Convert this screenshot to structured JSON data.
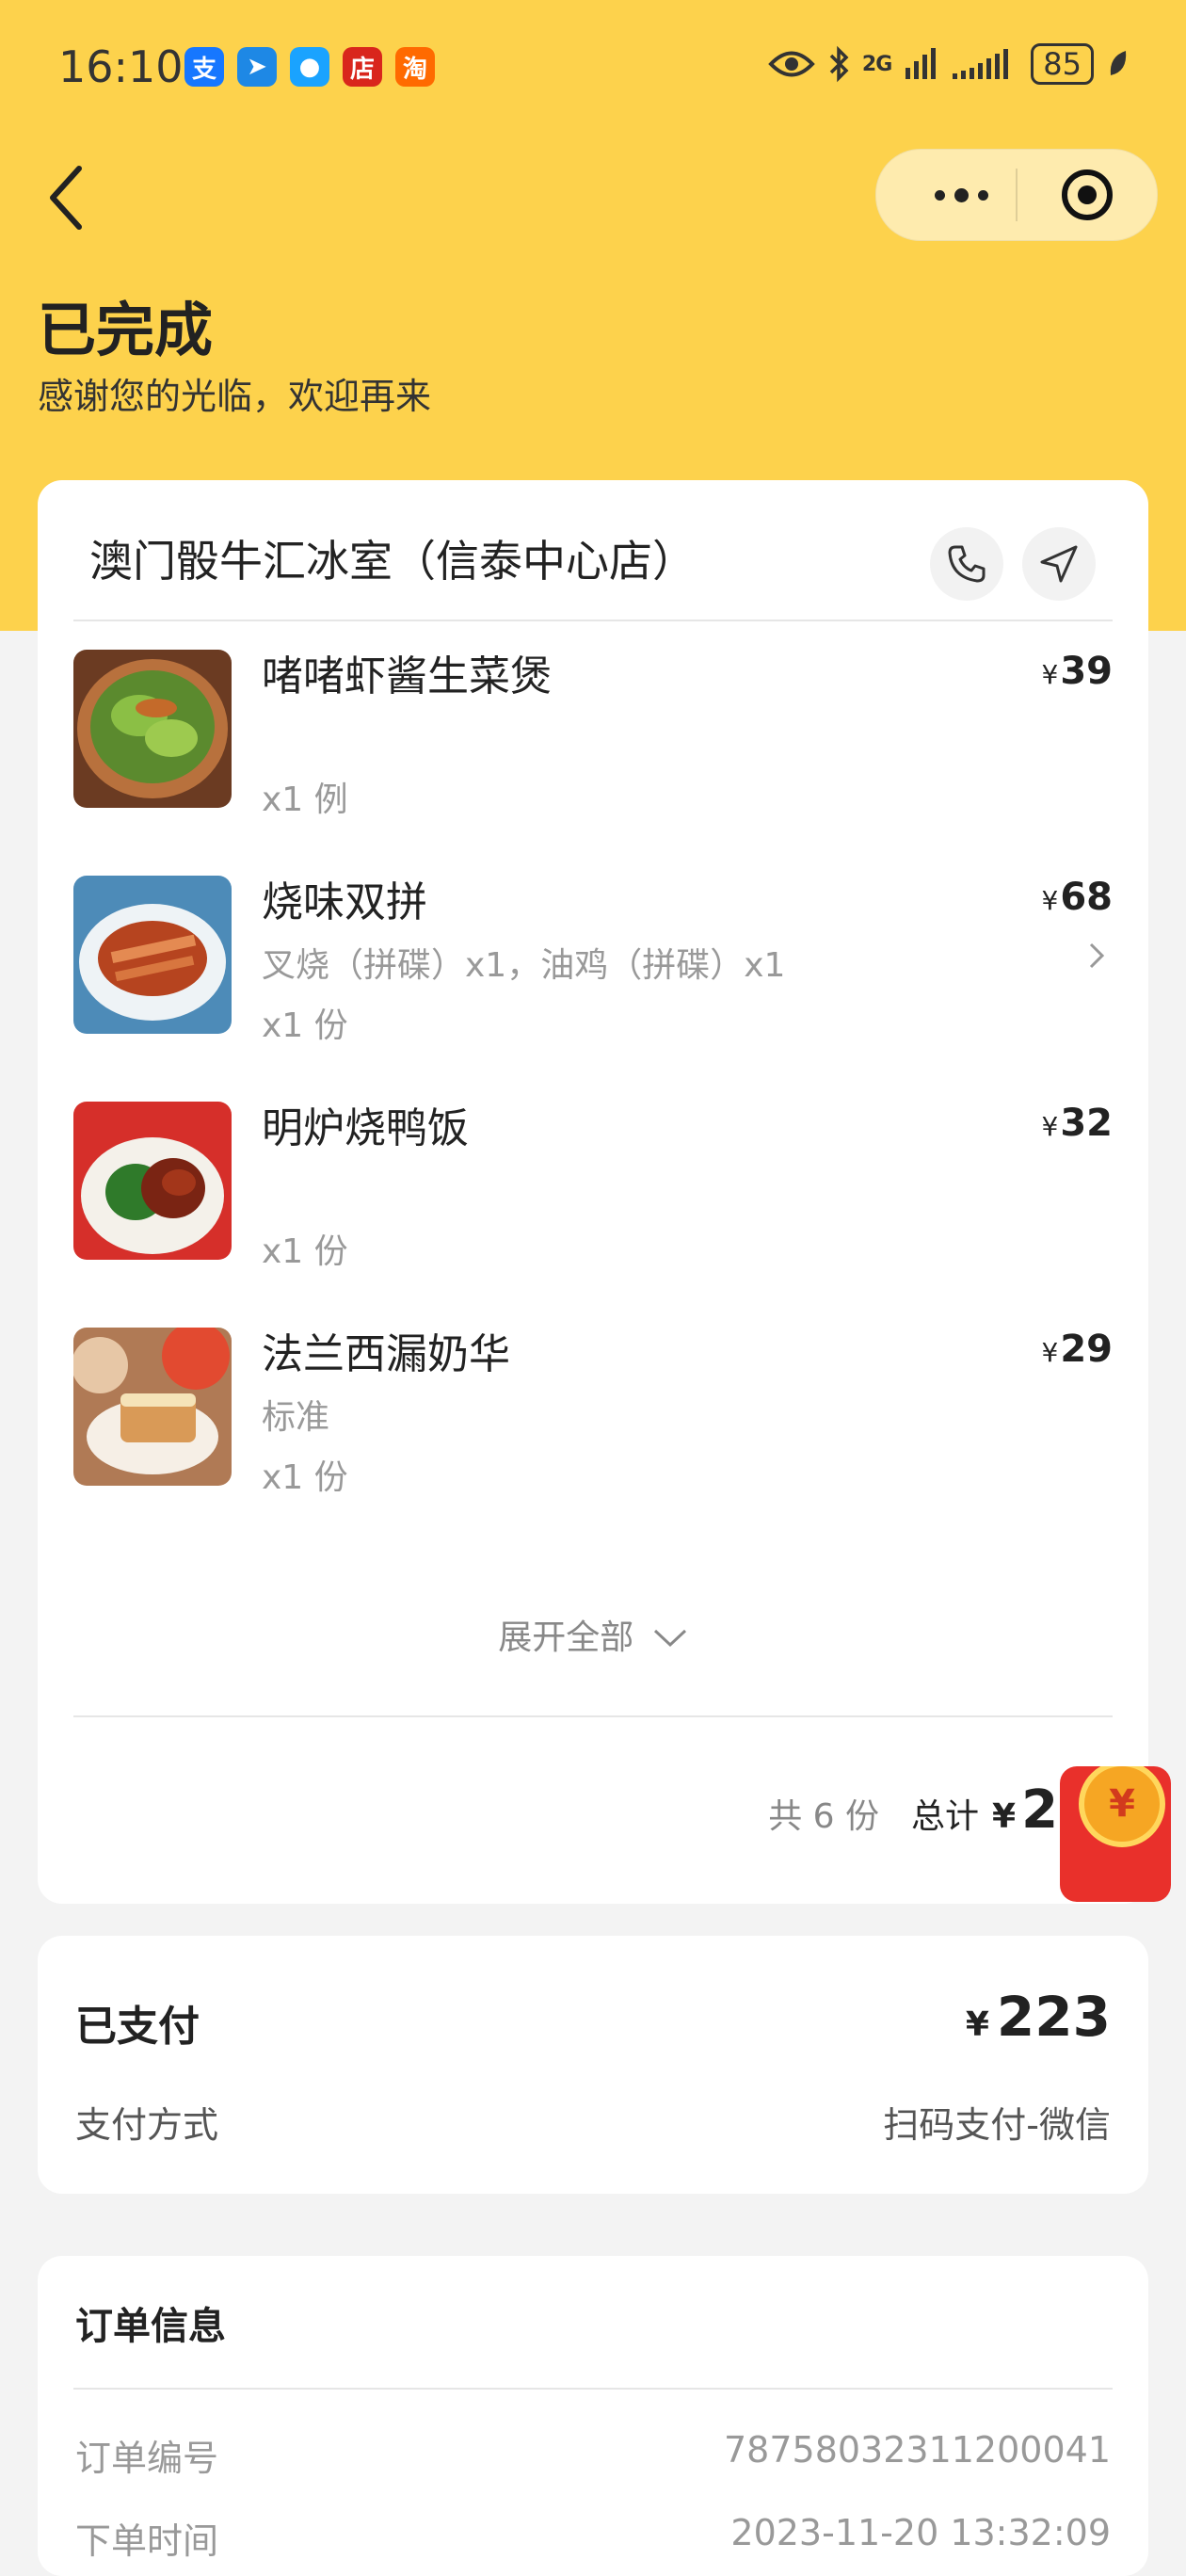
{
  "status_bar": {
    "time": "16:10",
    "apps": [
      {
        "glyph": "支",
        "color": "#1677ff"
      },
      {
        "glyph": "➤",
        "color": "#1e88e5"
      },
      {
        "glyph": "●",
        "color": "#1aa3ff"
      },
      {
        "glyph": "店",
        "color": "#d9261c"
      },
      {
        "glyph": "淘",
        "color": "#ff6a00"
      }
    ],
    "network": "2G",
    "battery": "85"
  },
  "header": {
    "status_title": "已完成",
    "status_subtitle": "感谢您的光临，欢迎再来"
  },
  "shop": {
    "name": "澳门骰牛汇冰室（信泰中心店）"
  },
  "items": [
    {
      "name": "啫啫虾酱生菜煲",
      "spec": "",
      "qty": "x1 例",
      "currency": "¥",
      "price": "39",
      "has_arrow": false
    },
    {
      "name": "烧味双拼",
      "spec": "叉烧（拼碟）x1，油鸡（拼碟）x1",
      "qty": "x1 份",
      "currency": "¥",
      "price": "68",
      "has_arrow": true
    },
    {
      "name": "明炉烧鸭饭",
      "spec": "",
      "qty": "x1 份",
      "currency": "¥",
      "price": "32",
      "has_arrow": false
    },
    {
      "name": "法兰西漏奶华",
      "spec": "标准",
      "qty": "x1 份",
      "currency": "¥",
      "price": "29",
      "has_arrow": false
    }
  ],
  "expand_label": "展开全部",
  "summary": {
    "count": "共 6 份",
    "total_label": "总计",
    "currency": "¥",
    "total_amount": "223"
  },
  "redpack_glyph": "¥",
  "payment": {
    "label": "已支付",
    "currency": "¥",
    "amount": "223",
    "method_label": "支付方式",
    "method": "扫码支付-微信"
  },
  "order_info": {
    "title": "订单信息",
    "rows": [
      {
        "label": "订单编号",
        "value": "78758032311200041"
      },
      {
        "label": "下单时间",
        "value": "2023-11-20 13:32:09"
      }
    ]
  }
}
